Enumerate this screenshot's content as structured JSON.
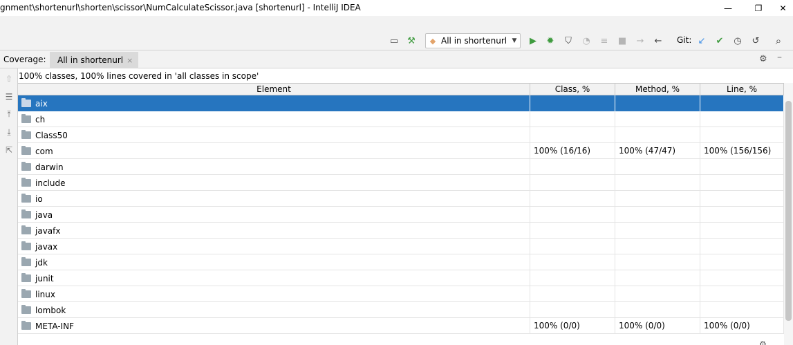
{
  "window": {
    "title": "gnment\\shortenurl\\shorten\\scissor\\NumCalculateScissor.java [shortenurl] - IntelliJ IDEA",
    "minimize_glyph": "—",
    "restore_glyph": "❐",
    "close_glyph": "✕"
  },
  "toolbar": {
    "run_config_label": "All in shortenurl",
    "git_label": "Git:",
    "icons": {
      "project_structure": "▭",
      "build": "⚒",
      "run": "▶",
      "debug": "✹",
      "coverage": "⛉",
      "profile": "◔",
      "more_run": "≡",
      "stop": "■",
      "forward": "→",
      "back": "←",
      "git_update": "↙",
      "git_commit": "✔",
      "git_history": "◷",
      "git_rollback": "↺",
      "search": "⌕"
    },
    "colors": {
      "run": "#3f9b3f",
      "debug": "#3f9b3f",
      "git_update": "#3d8ee6",
      "git_commit": "#3f9b3f"
    }
  },
  "coverage": {
    "label": "Coverage:",
    "tab_label": "All in shortenurl",
    "tab_close": "×",
    "summary": "100% classes, 100% lines covered in 'all classes in scope'",
    "columns": [
      "Element",
      "Class, %",
      "Method, %",
      "Line, %"
    ],
    "rows": [
      {
        "name": "aix",
        "class": "",
        "method": "",
        "line": "",
        "selected": true
      },
      {
        "name": "ch",
        "class": "",
        "method": "",
        "line": ""
      },
      {
        "name": "Class50",
        "class": "",
        "method": "",
        "line": ""
      },
      {
        "name": "com",
        "class": "100% (16/16)",
        "method": "100% (47/47)",
        "line": "100% (156/156)"
      },
      {
        "name": "darwin",
        "class": "",
        "method": "",
        "line": ""
      },
      {
        "name": "include",
        "class": "",
        "method": "",
        "line": ""
      },
      {
        "name": "io",
        "class": "",
        "method": "",
        "line": ""
      },
      {
        "name": "java",
        "class": "",
        "method": "",
        "line": ""
      },
      {
        "name": "javafx",
        "class": "",
        "method": "",
        "line": ""
      },
      {
        "name": "javax",
        "class": "",
        "method": "",
        "line": ""
      },
      {
        "name": "jdk",
        "class": "",
        "method": "",
        "line": ""
      },
      {
        "name": "junit",
        "class": "",
        "method": "",
        "line": ""
      },
      {
        "name": "linux",
        "class": "",
        "method": "",
        "line": ""
      },
      {
        "name": "lombok",
        "class": "",
        "method": "",
        "line": ""
      },
      {
        "name": "META-INF",
        "class": "100% (0/0)",
        "method": "100% (0/0)",
        "line": "100% (0/0)"
      }
    ],
    "accent": "#2675bf"
  }
}
